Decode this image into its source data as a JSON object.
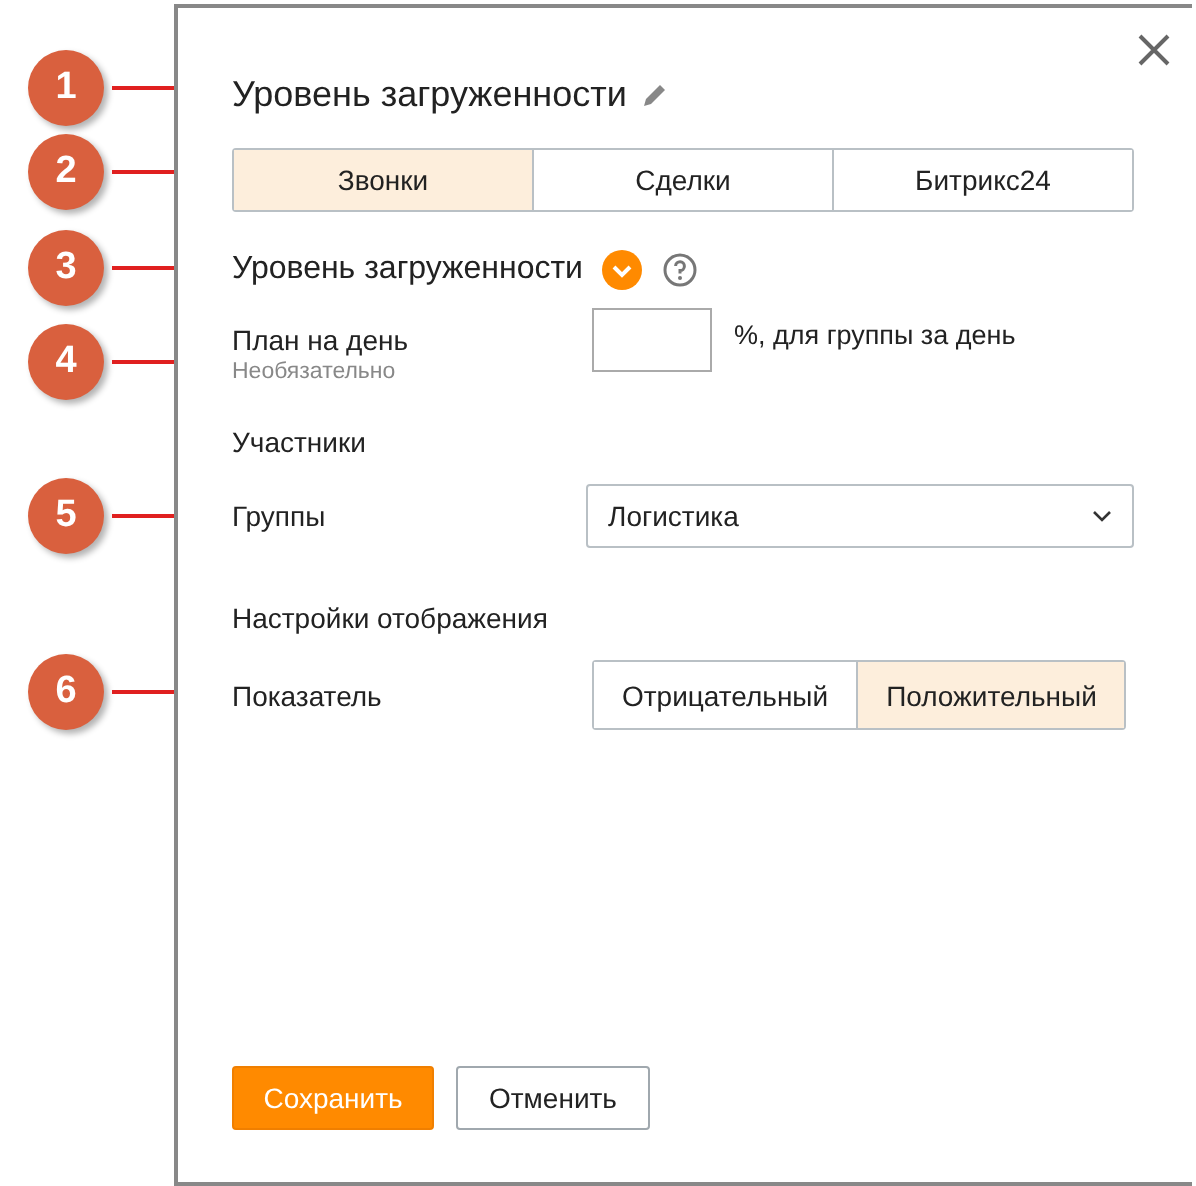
{
  "callouts": [
    "1",
    "2",
    "3",
    "4",
    "5",
    "6"
  ],
  "title": "Уровень загруженности",
  "tabs": [
    {
      "label": "Звонки",
      "selected": true
    },
    {
      "label": "Сделки",
      "selected": false
    },
    {
      "label": "Битрикс24",
      "selected": false
    }
  ],
  "section_title": "Уровень загруженности",
  "plan": {
    "label": "План на день",
    "hint": "Необязательно",
    "suffix": "%, для группы за день"
  },
  "participants_title": "Участники",
  "groups": {
    "label": "Группы",
    "value": "Логистика"
  },
  "display_title": "Настройки отображения",
  "indicator": {
    "label": "Показатель",
    "options": [
      {
        "label": "Отрицательный",
        "selected": false
      },
      {
        "label": "Положительный",
        "selected": true
      }
    ]
  },
  "buttons": {
    "save": "Сохранить",
    "cancel": "Отменить"
  }
}
